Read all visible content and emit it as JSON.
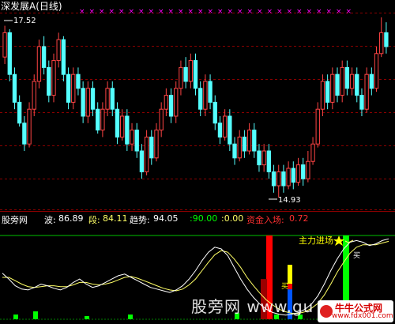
{
  "header": {
    "title": "深发展A(日线)",
    "price_high_label": "17.52",
    "price_low_label": "14.93"
  },
  "indicator_bar": {
    "name": "股旁网",
    "wave_label": "波:",
    "wave_value": "86.89",
    "segment_label": "段:",
    "segment_value": "84.11",
    "trend_label": "趋势:",
    "trend_value": "94.05",
    "level_high": ":90.00",
    "level_zero": ":0.00",
    "capital_label": "资金入场:",
    "capital_value": "0.72"
  },
  "annotations": {
    "main_force": "主力进场",
    "buy_small": "买",
    "buy_large": "买"
  },
  "watermark": {
    "text": "股旁网 www.gu",
    "logo_cn": "牛牛公式网",
    "logo_url": "www.fdx001.com"
  },
  "colors": {
    "background": "#000000",
    "up_candle": "#ff4444",
    "down_candle": "#54ffff",
    "grid": "#8b0000",
    "marker": "#ff00ff",
    "wave_line": "#ffffff",
    "segment_line": "#ffff66",
    "level_line": "#00ff00",
    "bar_red": "#ff0000",
    "bar_green": "#00ff00",
    "bar_yellow": "#ffff00",
    "bar_blue": "#0055ff",
    "bar_darkred": "#9b0000"
  },
  "chart_data": {
    "type": "candlestick",
    "price_high": 17.52,
    "price_low": 14.93,
    "candles": [
      [
        16.95,
        17.3,
        16.85,
        17.4
      ],
      [
        17.3,
        16.7,
        16.6,
        17.35
      ],
      [
        16.7,
        16.3,
        16.2,
        16.8
      ],
      [
        16.3,
        16.0,
        15.95,
        16.4
      ],
      [
        16.0,
        15.7,
        15.6,
        16.1
      ],
      [
        15.7,
        16.2,
        15.65,
        16.3
      ],
      [
        16.2,
        16.6,
        16.1,
        16.7
      ],
      [
        16.6,
        17.1,
        16.5,
        17.2
      ],
      [
        17.1,
        16.8,
        16.7,
        17.25
      ],
      [
        16.8,
        16.4,
        16.3,
        16.9
      ],
      [
        16.4,
        16.9,
        16.3,
        17.0
      ],
      [
        16.9,
        17.2,
        16.8,
        17.3
      ],
      [
        17.2,
        16.7,
        16.6,
        17.25
      ],
      [
        16.7,
        16.3,
        16.2,
        16.8
      ],
      [
        16.3,
        16.7,
        16.2,
        16.8
      ],
      [
        16.7,
        16.5,
        16.4,
        16.8
      ],
      [
        16.5,
        16.1,
        16.0,
        16.6
      ],
      [
        16.1,
        16.5,
        16.0,
        16.6
      ],
      [
        16.5,
        16.2,
        16.1,
        16.6
      ],
      [
        16.2,
        15.9,
        15.85,
        16.3
      ],
      [
        15.9,
        16.2,
        15.8,
        16.3
      ],
      [
        16.2,
        16.5,
        16.1,
        16.6
      ],
      [
        16.5,
        16.2,
        16.1,
        16.6
      ],
      [
        16.2,
        15.8,
        15.7,
        16.3
      ],
      [
        15.8,
        16.1,
        15.75,
        16.2
      ],
      [
        16.1,
        15.7,
        15.6,
        16.2
      ],
      [
        15.7,
        15.9,
        15.6,
        16.0
      ],
      [
        15.9,
        15.6,
        15.5,
        16.0
      ],
      [
        15.6,
        15.3,
        15.2,
        15.7
      ],
      [
        15.3,
        15.8,
        15.25,
        15.9
      ],
      [
        15.8,
        15.5,
        15.4,
        15.9
      ],
      [
        15.5,
        15.9,
        15.45,
        16.0
      ],
      [
        15.9,
        16.2,
        15.8,
        16.3
      ],
      [
        16.2,
        16.4,
        16.1,
        16.5
      ],
      [
        16.4,
        16.1,
        16.0,
        16.5
      ],
      [
        16.1,
        16.5,
        16.0,
        16.6
      ],
      [
        16.5,
        16.8,
        16.4,
        16.9
      ],
      [
        16.8,
        16.6,
        16.5,
        16.95
      ],
      [
        16.6,
        16.9,
        16.5,
        17.0
      ],
      [
        16.9,
        16.5,
        16.4,
        17.0
      ],
      [
        16.5,
        16.2,
        16.1,
        16.6
      ],
      [
        16.2,
        16.6,
        16.1,
        16.7
      ],
      [
        16.6,
        16.3,
        16.2,
        16.7
      ],
      [
        16.3,
        16.0,
        15.9,
        16.4
      ],
      [
        16.0,
        15.8,
        15.7,
        16.1
      ],
      [
        15.8,
        16.1,
        15.75,
        16.2
      ],
      [
        16.1,
        15.7,
        15.6,
        16.2
      ],
      [
        15.7,
        15.5,
        15.4,
        15.8
      ],
      [
        15.5,
        15.8,
        15.45,
        15.9
      ],
      [
        15.8,
        15.6,
        15.5,
        15.9
      ],
      [
        15.6,
        15.9,
        15.55,
        16.0
      ],
      [
        15.9,
        15.6,
        15.5,
        16.0
      ],
      [
        15.6,
        15.4,
        15.3,
        15.7
      ],
      [
        15.4,
        15.6,
        15.3,
        15.7
      ],
      [
        15.6,
        15.3,
        15.2,
        15.7
      ],
      [
        15.3,
        15.1,
        15.0,
        15.4
      ],
      [
        15.1,
        15.3,
        14.93,
        15.4
      ],
      [
        15.3,
        15.1,
        15.0,
        15.4
      ],
      [
        15.1,
        15.35,
        15.05,
        15.45
      ],
      [
        15.35,
        15.15,
        15.05,
        15.45
      ],
      [
        15.15,
        15.4,
        15.1,
        15.5
      ],
      [
        15.4,
        15.2,
        15.1,
        15.5
      ],
      [
        15.2,
        15.45,
        15.15,
        15.6
      ],
      [
        15.45,
        15.7,
        15.4,
        15.8
      ],
      [
        15.7,
        16.2,
        15.65,
        16.3
      ],
      [
        16.2,
        16.6,
        16.1,
        16.7
      ],
      [
        16.6,
        16.3,
        16.2,
        16.7
      ],
      [
        16.3,
        16.7,
        16.2,
        16.8
      ],
      [
        16.7,
        16.4,
        16.3,
        16.8
      ],
      [
        16.4,
        16.8,
        16.3,
        16.9
      ],
      [
        16.8,
        16.5,
        16.4,
        16.9
      ],
      [
        16.5,
        16.7,
        16.4,
        16.8
      ],
      [
        16.7,
        16.4,
        16.3,
        16.8
      ],
      [
        16.4,
        16.2,
        16.1,
        16.5
      ],
      [
        16.2,
        16.7,
        16.15,
        16.8
      ],
      [
        16.7,
        16.5,
        16.4,
        16.8
      ],
      [
        16.5,
        17.0,
        16.45,
        17.1
      ],
      [
        17.0,
        17.3,
        16.95,
        17.52
      ],
      [
        17.3,
        17.1,
        17.0,
        17.45
      ]
    ],
    "wave": [
      55,
      48,
      40,
      36,
      35,
      38,
      42,
      40,
      37,
      35,
      38,
      44,
      48,
      42,
      38,
      40,
      44,
      48,
      52,
      54,
      50,
      46,
      42,
      38,
      36,
      34,
      32,
      35,
      40,
      48,
      58,
      70,
      80,
      86,
      84,
      76,
      62,
      48,
      36,
      26,
      18,
      12,
      8,
      6,
      5,
      6,
      8,
      12,
      18,
      28,
      42,
      58,
      72,
      84,
      92,
      94,
      92,
      88,
      90,
      94,
      96
    ],
    "segment": [
      50,
      50,
      46,
      42,
      39,
      38,
      39,
      40,
      40,
      39,
      39,
      41,
      44,
      44,
      42,
      41,
      42,
      44,
      47,
      50,
      51,
      49,
      46,
      43,
      40,
      37,
      35,
      34,
      36,
      41,
      48,
      58,
      68,
      77,
      82,
      80,
      72,
      62,
      50,
      40,
      31,
      23,
      17,
      12,
      9,
      7,
      7,
      9,
      13,
      19,
      29,
      42,
      56,
      68,
      79,
      86,
      89,
      89,
      89,
      91,
      93
    ],
    "green_dots": [
      [
        0.04,
        3
      ],
      [
        0.09,
        5
      ],
      [
        0.22,
        2
      ],
      [
        0.33,
        3
      ],
      [
        0.6,
        4
      ],
      [
        0.7,
        3
      ],
      [
        0.76,
        3
      ]
    ],
    "bars": [
      {
        "pos": 0.682,
        "color": "red",
        "value": 100
      },
      {
        "pos": 0.668,
        "color": "darkred",
        "value": 48
      },
      {
        "pos": 0.734,
        "color": "yellow_blue",
        "value": 65
      },
      {
        "pos": 0.876,
        "color": "green",
        "value": 100
      }
    ]
  }
}
